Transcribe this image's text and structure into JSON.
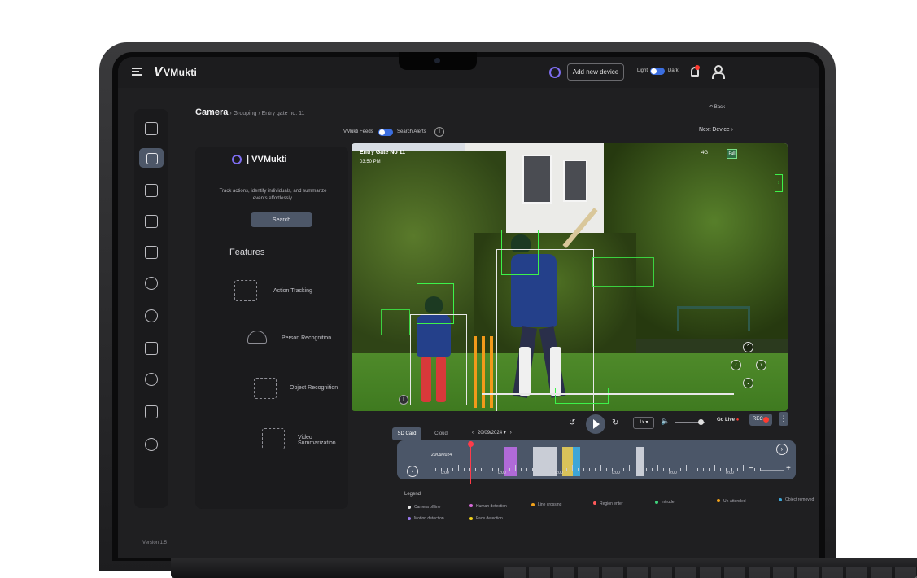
{
  "app": {
    "brand": "VMukti",
    "add_device": "Add new device",
    "theme_light": "Light",
    "theme_dark": "Dark"
  },
  "breadcrumb": {
    "main": "Camera",
    "level2": "Grouping",
    "level3": "Entry gate no. 11",
    "back": "Back"
  },
  "toolbar": {
    "feeds_label": "VMukti Feeds",
    "alerts_label": "Search Alerts",
    "info": "i",
    "next_device": "Next Device"
  },
  "ai_panel": {
    "brand": "VMukti",
    "tagline": "Track actions, identify individuals, and summarize events effortlessly.",
    "search_label": "Search",
    "features_title": "Features",
    "features": [
      {
        "label": "Action Tracking",
        "icon": "action-tracking-icon"
      },
      {
        "label": "Person Recognition",
        "icon": "person-recognition-icon"
      },
      {
        "label": "Object Recognition",
        "icon": "object-recognition-icon"
      },
      {
        "label": "Video Summarization",
        "icon": "video-summarization-icon"
      }
    ],
    "version": "Version 1.5"
  },
  "video": {
    "camera_name": "Entry Gate No 11",
    "time": "03:50 PM",
    "signal": "4G",
    "full_label": "Full",
    "info": "i"
  },
  "playback": {
    "tab_sd": "SD Card",
    "tab_cloud": "Cloud",
    "date": "20/09/2024",
    "speed": "1x",
    "go_live": "Go Live",
    "rec": "REC",
    "more": "⋮"
  },
  "timeline": {
    "date": "20/09/2024",
    "labels": [
      "0:00",
      "0:00",
      "0:00",
      "0:00",
      "0:00",
      "0:00"
    ],
    "segments": [
      {
        "color": "#b06ad8",
        "start": 0.27,
        "width": 0.03
      },
      {
        "color": "#c9cdd6",
        "start": 0.34,
        "width": 0.06
      },
      {
        "color": "#d8c25a",
        "start": 0.415,
        "width": 0.025
      },
      {
        "color": "#3ea6d8",
        "start": 0.44,
        "width": 0.02
      },
      {
        "color": "#c9cdd6",
        "start": 0.6,
        "width": 0.02
      }
    ]
  },
  "legend": {
    "title": "Legend",
    "items": [
      {
        "label": "Camera offline",
        "color": "#e6e6e6"
      },
      {
        "label": "Human detection",
        "color": "#d66ad8"
      },
      {
        "label": "Line crossing",
        "color": "#f2a21a"
      },
      {
        "label": "Region enter",
        "color": "#ff5a5a"
      },
      {
        "label": "Intrude",
        "color": "#3fd07a"
      },
      {
        "label": "Un-attended",
        "color": "#f2a21a"
      },
      {
        "label": "Object removed",
        "color": "#3ea6d8"
      },
      {
        "label": "Motion detection",
        "color": "#9a7af0"
      },
      {
        "label": "Face detection",
        "color": "#f2d21a"
      }
    ]
  }
}
